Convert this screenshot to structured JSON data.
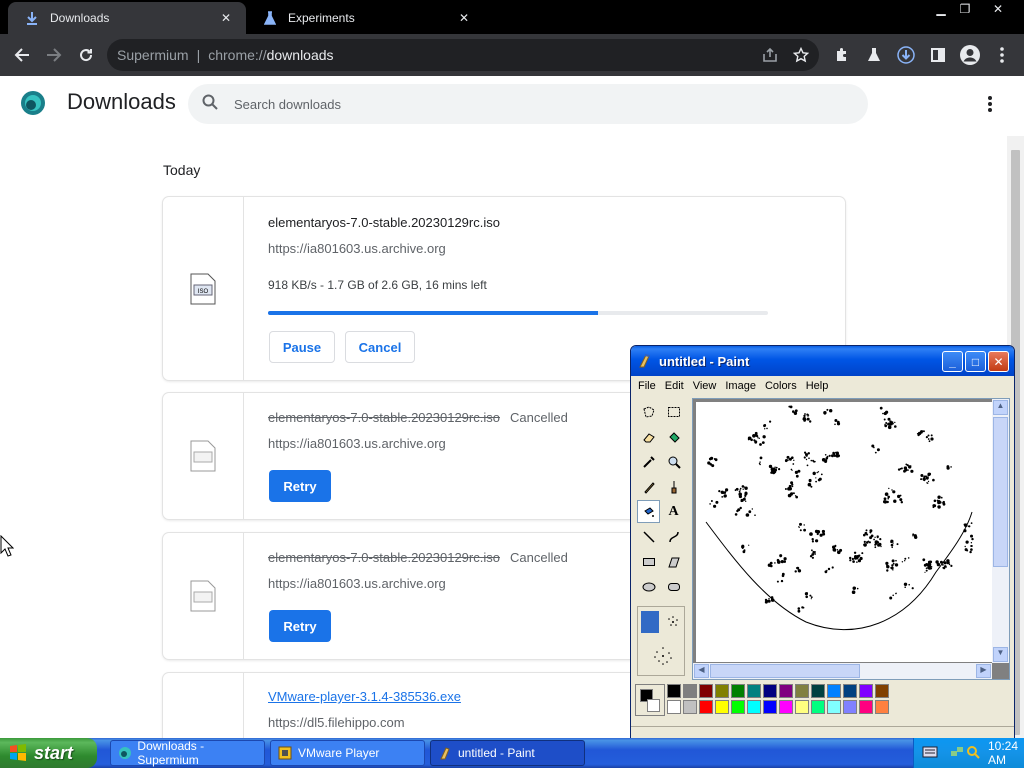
{
  "tabs": [
    {
      "title": "Downloads",
      "active": true,
      "icon": "download-icon"
    },
    {
      "title": "Experiments",
      "active": false,
      "icon": "flask-icon"
    }
  ],
  "omnibox": {
    "origin": "Supermium",
    "separator": "|",
    "url_scheme": "chrome://",
    "url_host": "downloads"
  },
  "downloads_page": {
    "title": "Downloads",
    "search_placeholder": "Search downloads",
    "date_group": "Today",
    "items": [
      {
        "filename": "elementaryos-7.0-stable.20230129rc.iso",
        "url": "https://ia801603.us.archive.org",
        "progress_text": "918 KB/s - 1.7 GB of 2.6 GB, 16 mins left",
        "progress_fraction": 0.66,
        "buttons": [
          "Pause",
          "Cancel"
        ]
      },
      {
        "filename": "elementaryos-7.0-stable.20230129rc.iso",
        "status": "Cancelled",
        "url": "https://ia801603.us.archive.org",
        "button": "Retry"
      },
      {
        "filename": "elementaryos-7.0-stable.20230129rc.iso",
        "status": "Cancelled",
        "url": "https://ia801603.us.archive.org",
        "button": "Retry"
      },
      {
        "filename": "VMware-player-3.1.4-385536.exe",
        "url": "https://dl5.filehippo.com"
      }
    ]
  },
  "paint": {
    "title": "untitled - Paint",
    "menu": [
      "File",
      "Edit",
      "View",
      "Image",
      "Colors",
      "Help"
    ],
    "palette_colors": [
      "#000000",
      "#808080",
      "#800000",
      "#808000",
      "#008000",
      "#008080",
      "#000080",
      "#800080",
      "#808040",
      "#004040",
      "#0080ff",
      "#004080",
      "#8000ff",
      "#804000",
      "#ffffff",
      "#c0c0c0",
      "#ff0000",
      "#ffff00",
      "#00ff00",
      "#00ffff",
      "#0000ff",
      "#ff00ff",
      "#ffff80",
      "#00ff80",
      "#80ffff",
      "#8080ff",
      "#ff0080",
      "#ff8040"
    ],
    "primary_color": "#000000",
    "secondary_color": "#ffffff"
  },
  "taskbar": {
    "start_label": "start",
    "tasks": [
      {
        "label": "Downloads - Supermium",
        "active": false
      },
      {
        "label": "VMware Player",
        "active": false
      },
      {
        "label": "untitled - Paint",
        "active": true
      }
    ],
    "clock": "10:24 AM"
  },
  "colors": {
    "accent": "#1a73e8",
    "chrome_dark": "#35363a",
    "xp_blue": "#245edb",
    "xp_green": "#3c9a3c"
  }
}
